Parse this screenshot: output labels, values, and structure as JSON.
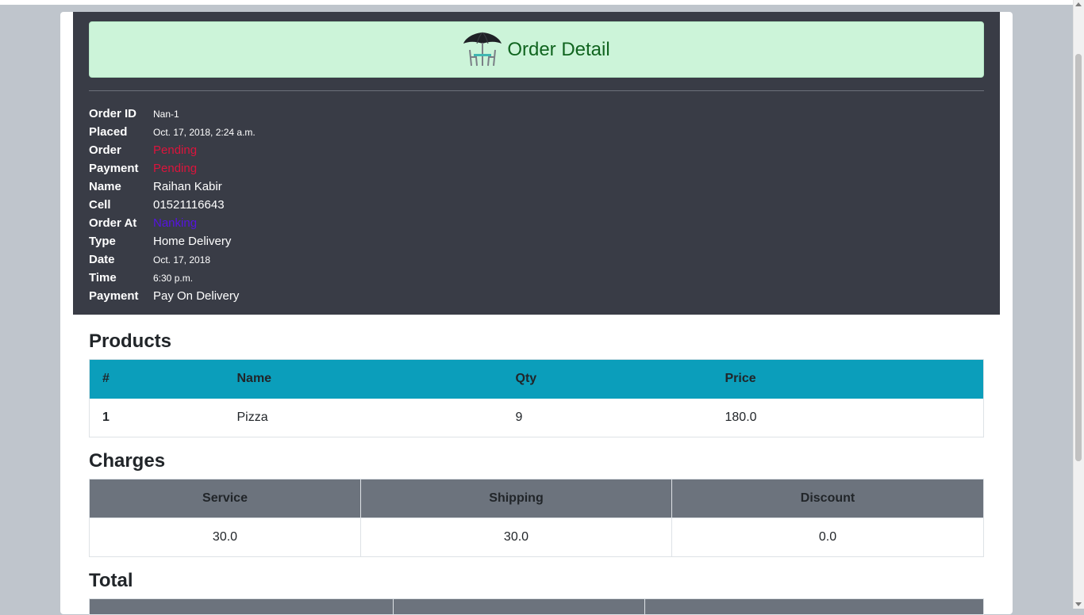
{
  "header": {
    "title": "Order Detail",
    "icon": "umbrella-table-icon"
  },
  "details": [
    {
      "label": "Order ID",
      "value": "Nan-1",
      "style": "small"
    },
    {
      "label": "Placed",
      "value": "Oct. 17, 2018, 2:24 a.m.",
      "style": "small"
    },
    {
      "label": "Order",
      "value": "Pending",
      "style": "danger"
    },
    {
      "label": "Payment",
      "value": "Pending",
      "style": "danger"
    },
    {
      "label": "Name",
      "value": "Raihan Kabir",
      "style": "normal"
    },
    {
      "label": "Cell",
      "value": "01521116643",
      "style": "normal"
    },
    {
      "label": "Order At",
      "value": "Nanking",
      "style": "branch"
    },
    {
      "label": "Type",
      "value": "Home Delivery",
      "style": "normal"
    },
    {
      "label": "Date",
      "value": "Oct. 17, 2018",
      "style": "small"
    },
    {
      "label": "Time",
      "value": "6:30 p.m.",
      "style": "small"
    },
    {
      "label": "Payment",
      "value": "Pay On Delivery",
      "style": "normal"
    }
  ],
  "products": {
    "title": "Products",
    "columns": [
      "#",
      "Name",
      "Qty",
      "Price"
    ],
    "rows": [
      [
        "1",
        "Pizza",
        "9",
        "180.0"
      ]
    ]
  },
  "charges": {
    "title": "Charges",
    "columns": [
      "Service",
      "Shipping",
      "Discount"
    ],
    "values": [
      "30.0",
      "30.0",
      "0.0"
    ]
  },
  "total": {
    "title": "Total"
  },
  "colors": {
    "header_bg": "#ccf4d9",
    "header_text": "#10641f",
    "panel_bg": "#393c46",
    "products_head": "#0b9ebb",
    "charges_head": "#6c737d",
    "danger": "#dc143c",
    "branch": "#5514e0"
  }
}
